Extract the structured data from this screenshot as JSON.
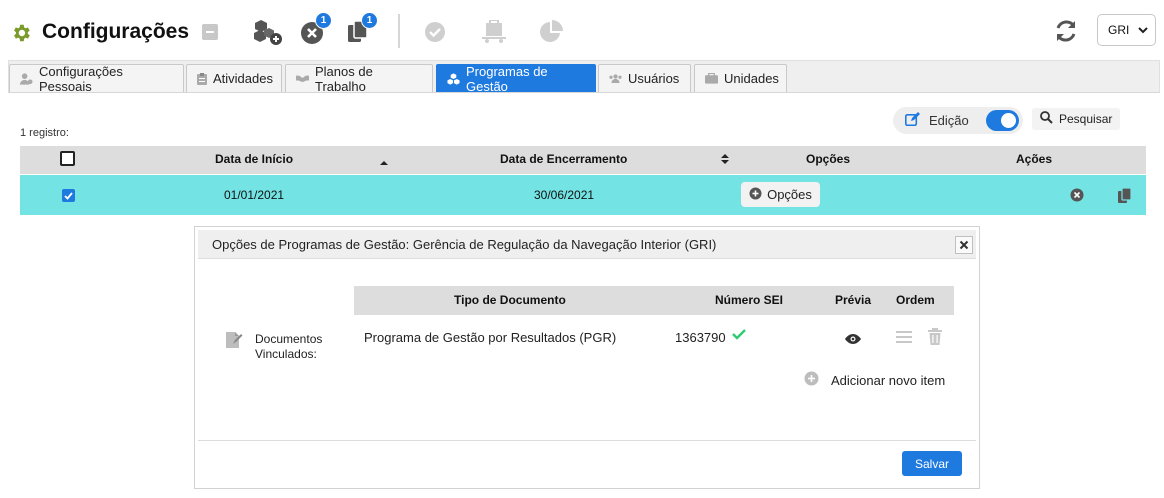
{
  "header": {
    "title": "Configurações",
    "toolbar": [
      {
        "name": "minimize-button",
        "icon": "minus-square-icon"
      },
      {
        "name": "add-entity-button",
        "icon": "cubes-add-icon"
      },
      {
        "name": "errors-button",
        "icon": "x-circle-icon",
        "badge": "1"
      },
      {
        "name": "copies-button",
        "icon": "copy-icon",
        "badge": "1"
      },
      {
        "name": "approve-button",
        "icon": "check-circle-icon"
      },
      {
        "name": "cart-button",
        "icon": "cart-icon"
      },
      {
        "name": "report-button",
        "icon": "pie-chart-icon"
      }
    ],
    "refresh_icon": "refresh-icon",
    "unit": "GRI"
  },
  "tabs": [
    {
      "label": "Configurações Pessoais",
      "icon": "user-cog-icon",
      "active": false
    },
    {
      "label": "Atividades",
      "icon": "clipboard-icon",
      "active": false
    },
    {
      "label": "Planos de Trabalho",
      "icon": "handshake-icon",
      "active": false
    },
    {
      "label": "Programas de Gestão",
      "icon": "cubes-icon",
      "active": true
    },
    {
      "label": "Usuários",
      "icon": "users-icon",
      "active": false
    },
    {
      "label": "Unidades",
      "icon": "briefcase-icon",
      "active": false
    }
  ],
  "controls": {
    "edit_label": "Edição",
    "edit_enabled": true,
    "search_label": "Pesquisar"
  },
  "grid": {
    "record_count": "1 registro:",
    "columns": [
      "Data de Início",
      "Data de Encerramento",
      "Opções",
      "Ações"
    ],
    "rows": [
      {
        "start": "01/01/2021",
        "end": "30/06/2021",
        "options_label": "Opções",
        "selected": true
      }
    ]
  },
  "panel": {
    "title": "Opções de Programas de Gestão: Gerência de Regulação da Navegação Interior (GRI)",
    "doc_label": "Documentos Vinculados:",
    "columns": [
      "Tipo de Documento",
      "Número SEI",
      "Prévia",
      "Ordem"
    ],
    "rows": [
      {
        "type": "Programa de Gestão por Resultados (PGR)",
        "number": "1363790",
        "verified": true
      }
    ],
    "add_item_label": "Adicionar novo item",
    "save_label": "Salvar"
  },
  "colors": {
    "accent": "#1f7ae0",
    "selected_row": "#74e3e3",
    "gear": "#7a9a2a",
    "success": "#2ecc71"
  }
}
